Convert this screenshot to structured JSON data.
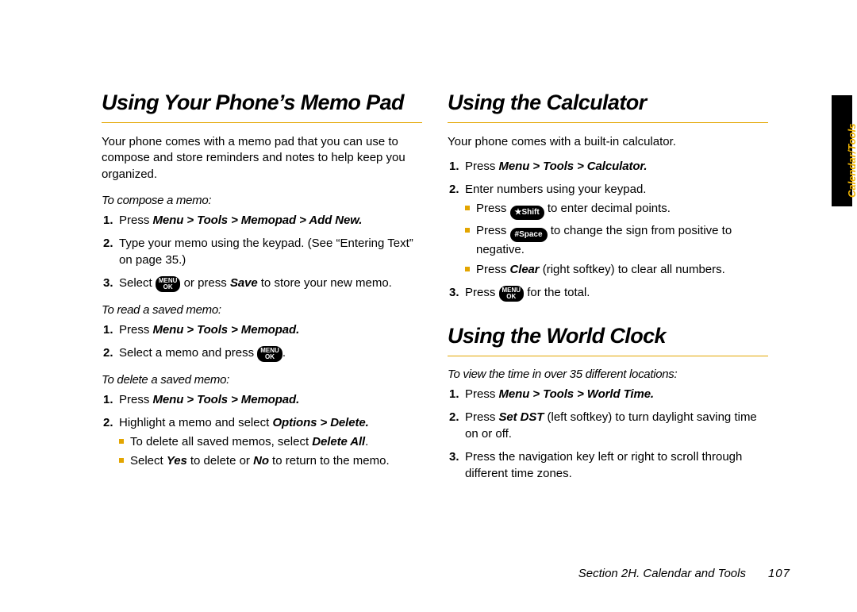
{
  "side_tab": "Calendar/Tools",
  "footer": {
    "section": "Section 2H. Calendar and Tools",
    "page": "107"
  },
  "left": {
    "h1": "Using Your Phone’s Memo Pad",
    "intro": "Your phone comes with a memo pad that you can use to compose and store reminders and notes to help keep you organized.",
    "sec1": {
      "head": "To compose a memo:",
      "s1a": "Press ",
      "s1b": "Menu > Tools > Memopad > Add New.",
      "s2": "Type your memo using the keypad. (See “Entering Text” on page 35.)",
      "s3a": "Select ",
      "s3b": " or press ",
      "s3c": "Save",
      "s3d": " to store your new memo."
    },
    "sec2": {
      "head": "To read a saved memo:",
      "s1a": "Press ",
      "s1b": "Menu > Tools > Memopad.",
      "s2a": "Select a memo and press ",
      "s2b": "."
    },
    "sec3": {
      "head": "To delete a saved memo:",
      "s1a": "Press ",
      "s1b": "Menu > Tools > Memopad.",
      "s2a": "Highlight a memo and select ",
      "s2b": "Options > Delete.",
      "sub1a": "To delete all saved memos, select ",
      "sub1b": "Delete All",
      "sub1c": ".",
      "sub2a": "Select ",
      "sub2b": "Yes",
      "sub2c": " to delete or ",
      "sub2d": "No",
      "sub2e": " to return to the memo."
    }
  },
  "right": {
    "h1a": "Using the Calculator",
    "introa": "Your phone comes with a built-in calculator.",
    "calc": {
      "s1a": "Press ",
      "s1b": "Menu > Tools > Calculator.",
      "s2": "Enter numbers using your keypad.",
      "sub1a": "Press ",
      "sub1b": " to enter decimal points.",
      "sub2a": "Press ",
      "sub2b": " to change the sign from positive to negative.",
      "sub3a": "Press ",
      "sub3b": "Clear",
      "sub3c": " (right softkey) to clear all numbers.",
      "s3a": "Press ",
      "s3b": " for the total."
    },
    "h1b": "Using the World Clock",
    "wc": {
      "head": "To view the time in over 35 different locations:",
      "s1a": "Press ",
      "s1b": "Menu > Tools > World Time.",
      "s2a": "Press ",
      "s2b": "Set DST",
      "s2c": " (left softkey) to turn daylight saving time on or off.",
      "s3": "Press the navigation key left or right to scroll through different time zones."
    }
  },
  "keys": {
    "menu_top": "MENU",
    "menu_bot": "OK",
    "star": "★Shift",
    "hash": "#Space"
  }
}
